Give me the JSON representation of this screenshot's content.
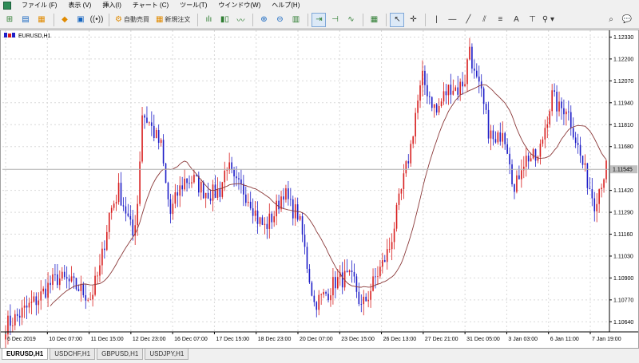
{
  "menu": [
    {
      "label": "ファイル (F)"
    },
    {
      "label": "表示 (V)"
    },
    {
      "label": "挿入(I)"
    },
    {
      "label": "チャート (C)"
    },
    {
      "label": "ツール(T)"
    },
    {
      "label": "ウインドウ(W)"
    },
    {
      "label": "ヘルプ(H)"
    }
  ],
  "toolbar": {
    "auto_trading_label": "自動売買",
    "new_order_label": "新規注文"
  },
  "chart": {
    "title": "EURUSD,H1",
    "colors": {
      "bull": "#d81f1f",
      "bear": "#1f1fc8",
      "ma": "#8b3a3a",
      "grid": "#d9d9d9",
      "price_line": "#b0b0b0",
      "price_label_bg": "#c0c0c0"
    },
    "current_price": "1.11545",
    "y_ticks": [
      "1.12330",
      "1.12200",
      "1.12070",
      "1.11940",
      "1.11810",
      "1.11680",
      "1.11420",
      "1.11290",
      "1.11160",
      "1.11030",
      "1.10900",
      "1.10770",
      "1.10640"
    ],
    "x_ticks": [
      "6 Dec 2019",
      "10 Dec 07:00",
      "11 Dec 15:00",
      "12 Dec 23:00",
      "16 Dec 07:00",
      "17 Dec 15:00",
      "18 Dec 23:00",
      "20 Dec 07:00",
      "23 Dec 15:00",
      "26 Dec 13:00",
      "27 Dec 21:00",
      "31 Dec 05:00",
      "3 Jan 03:00",
      "6 Jan 11:00",
      "7 Jan 19:00"
    ]
  },
  "chart_data": {
    "type": "candlestick",
    "title": "EURUSD,H1",
    "ylim": [
      1.1058,
      1.1237
    ],
    "y_ticks": [
      1.1233,
      1.122,
      1.1207,
      1.1194,
      1.1181,
      1.1168,
      1.1142,
      1.1129,
      1.1116,
      1.1103,
      1.109,
      1.1077,
      1.1064
    ],
    "x_ticks": [
      "6 Dec 2019",
      "10 Dec 07:00",
      "11 Dec 15:00",
      "12 Dec 23:00",
      "16 Dec 07:00",
      "17 Dec 15:00",
      "18 Dec 23:00",
      "20 Dec 07:00",
      "23 Dec 15:00",
      "26 Dec 13:00",
      "27 Dec 21:00",
      "31 Dec 05:00",
      "3 Jan 03:00",
      "6 Jan 11:00",
      "7 Jan 19:00"
    ],
    "close_path": [
      [
        0,
        1.1062
      ],
      [
        4,
        1.1066
      ],
      [
        9,
        1.1072
      ],
      [
        14,
        1.1078
      ],
      [
        18,
        1.1085
      ],
      [
        22,
        1.109
      ],
      [
        26,
        1.1088
      ],
      [
        31,
        1.1084
      ],
      [
        36,
        1.1078
      ],
      [
        40,
        1.1095
      ],
      [
        44,
        1.1128
      ],
      [
        48,
        1.1142
      ],
      [
        51,
        1.113
      ],
      [
        54,
        1.1115
      ],
      [
        56,
        1.1135
      ],
      [
        58,
        1.1188
      ],
      [
        61,
        1.1182
      ],
      [
        63,
        1.1176
      ],
      [
        66,
        1.1168
      ],
      [
        68,
        1.1145
      ],
      [
        70,
        1.1128
      ],
      [
        73,
        1.114
      ],
      [
        76,
        1.1148
      ],
      [
        80,
        1.1148
      ],
      [
        84,
        1.1142
      ],
      [
        88,
        1.114
      ],
      [
        91,
        1.1142
      ],
      [
        94,
        1.1158
      ],
      [
        97,
        1.1146
      ],
      [
        101,
        1.1142
      ],
      [
        104,
        1.1136
      ],
      [
        107,
        1.1125
      ],
      [
        110,
        1.112
      ],
      [
        114,
        1.1128
      ],
      [
        118,
        1.1142
      ],
      [
        121,
        1.1132
      ],
      [
        124,
        1.1128
      ],
      [
        126,
        1.1115
      ],
      [
        128,
        1.1098
      ],
      [
        131,
        1.1075
      ],
      [
        134,
        1.1078
      ],
      [
        137,
        1.1082
      ],
      [
        140,
        1.1088
      ],
      [
        144,
        1.109
      ],
      [
        148,
        1.1088
      ],
      [
        151,
        1.1072
      ],
      [
        154,
        1.108
      ],
      [
        157,
        1.109
      ],
      [
        160,
        1.1098
      ],
      [
        163,
        1.1108
      ],
      [
        166,
        1.1128
      ],
      [
        169,
        1.1148
      ],
      [
        172,
        1.1168
      ],
      [
        174,
        1.1188
      ],
      [
        177,
        1.1208
      ],
      [
        180,
        1.1198
      ],
      [
        183,
        1.1188
      ],
      [
        186,
        1.1198
      ],
      [
        189,
        1.1204
      ],
      [
        192,
        1.1202
      ],
      [
        195,
        1.1208
      ],
      [
        197,
        1.1228
      ],
      [
        199,
        1.121
      ],
      [
        202,
        1.1198
      ],
      [
        205,
        1.1178
      ],
      [
        208,
        1.1168
      ],
      [
        211,
        1.118
      ],
      [
        214,
        1.1162
      ],
      [
        216,
        1.114
      ],
      [
        219,
        1.1158
      ],
      [
        222,
        1.1162
      ],
      [
        226,
        1.116
      ],
      [
        229,
        1.118
      ],
      [
        232,
        1.1198
      ],
      [
        235,
        1.119
      ],
      [
        238,
        1.1192
      ],
      [
        241,
        1.1178
      ],
      [
        244,
        1.1162
      ],
      [
        247,
        1.1148
      ],
      [
        250,
        1.1135
      ],
      [
        253,
        1.1148
      ],
      [
        255,
        1.1155
      ]
    ],
    "n_bars": 256,
    "moving_average": {
      "period": 20,
      "color": "#8b3a3a"
    },
    "current_price": 1.11545
  },
  "tabs": [
    {
      "label": "EURUSD,H1",
      "active": true
    },
    {
      "label": "USDCHF,H1",
      "active": false
    },
    {
      "label": "GBPUSD,H1",
      "active": false
    },
    {
      "label": "USDJPY,H1",
      "active": false
    }
  ]
}
